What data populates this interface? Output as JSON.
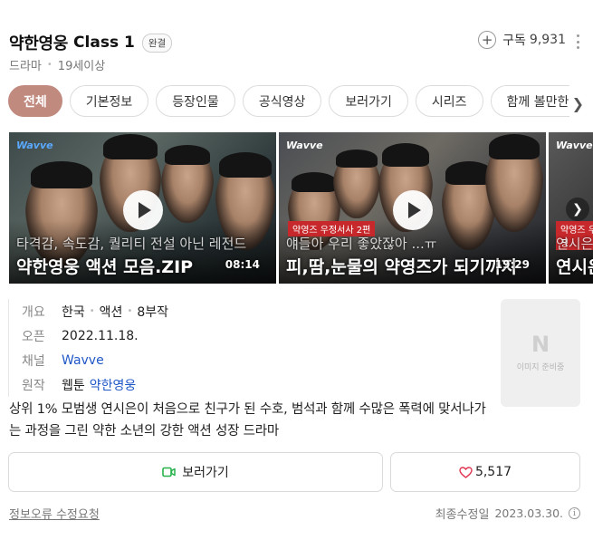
{
  "header": {
    "title_ko": "약한영웅",
    "title_en": "Class 1",
    "status_badge": "완결",
    "genre": "드라마",
    "rating": "19세이상",
    "subscribe_label": "구독",
    "subscribe_count": "9,931"
  },
  "tabs": [
    {
      "label": "전체",
      "active": true
    },
    {
      "label": "기본정보"
    },
    {
      "label": "등장인물"
    },
    {
      "label": "공식영상"
    },
    {
      "label": "보러가기"
    },
    {
      "label": "시리즈"
    },
    {
      "label": "함께 볼만한"
    }
  ],
  "videos": [
    {
      "logo": "Wavve",
      "caption_small": "타격감, 속도감, 퀄리티 전설 아닌 레전드",
      "caption_large": "약한영웅 액션 모음.ZIP",
      "duration": "08:14"
    },
    {
      "logo": "Wavve",
      "tag": "약영즈 우정서사 2편",
      "caption_small": "얘들아 우리 좋았잖아 ...ㅠ",
      "caption_large": "피,땀,눈물의 약영즈가 되기까지",
      "duration": "19:29"
    },
    {
      "logo": "Wavve",
      "tag": "약영즈 우정",
      "caption_small": "연시은",
      "caption_large": "연시은"
    }
  ],
  "info": {
    "overview_key": "개요",
    "overview_country": "한국",
    "overview_genre": "액션",
    "overview_episodes": "8부작",
    "release_key": "오픈",
    "release_date": "2022.11.18.",
    "channel_key": "채널",
    "channel_value": "Wavve",
    "original_key": "원작",
    "original_type": "웹툰",
    "original_title": "약한영웅"
  },
  "poster": {
    "letter": "N",
    "placeholder": "이미지 준비중"
  },
  "description": "상위 1% 모범생 연시은이 처음으로 친구가 된 수호, 범석과 함께 수많은 폭력에 맞서나가는 과정을 그린 약한 소년의 강한 액션 성장 드라마",
  "actions": {
    "watch_label": "보러가기",
    "like_count": "5,517"
  },
  "footer": {
    "report_label": "정보오류 수정요청",
    "updated_label": "최종수정일",
    "updated_date": "2023.03.30."
  },
  "colors": {
    "accent": "#c18a7f",
    "link": "#2057c7",
    "watch_icon": "#27b24a",
    "heart": "#e0334f"
  }
}
